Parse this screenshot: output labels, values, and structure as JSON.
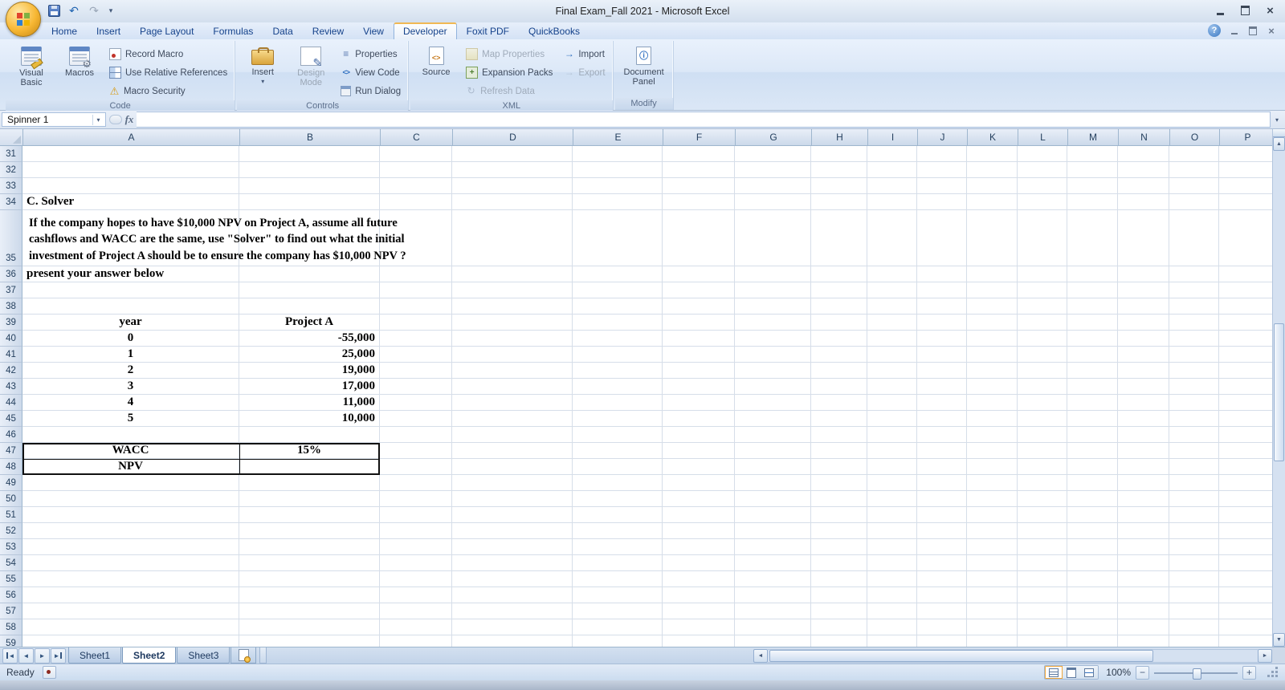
{
  "window": {
    "title": "Final Exam_Fall 2021  -  Microsoft Excel"
  },
  "ribbon": {
    "tabs": [
      "Home",
      "Insert",
      "Page Layout",
      "Formulas",
      "Data",
      "Review",
      "View",
      "Developer",
      "Foxit PDF",
      "QuickBooks"
    ],
    "active_tab": "Developer",
    "groups": {
      "code": {
        "label": "Code",
        "visual_basic": "Visual Basic",
        "macros": "Macros",
        "record_macro": "Record Macro",
        "use_relative_references": "Use Relative References",
        "macro_security": "Macro Security"
      },
      "controls": {
        "label": "Controls",
        "insert": "Insert",
        "design_mode": "Design Mode",
        "properties": "Properties",
        "view_code": "View Code",
        "run_dialog": "Run Dialog"
      },
      "xml": {
        "label": "XML",
        "source": "Source",
        "map_properties": "Map Properties",
        "expansion_packs": "Expansion Packs",
        "refresh_data": "Refresh Data",
        "import": "Import",
        "export": "Export"
      },
      "modify": {
        "label": "Modify",
        "document_panel": "Document Panel"
      }
    }
  },
  "formula_bar": {
    "name_box": "Spinner 1",
    "fx": "fx",
    "formula": ""
  },
  "grid": {
    "columns": [
      "A",
      "B",
      "C",
      "D",
      "E",
      "F",
      "G",
      "H",
      "I",
      "J",
      "K",
      "L",
      "M",
      "N",
      "O",
      "P"
    ],
    "rows": [
      31,
      32,
      33,
      34,
      35,
      36,
      37,
      38,
      39,
      40,
      41,
      42,
      43,
      44,
      45,
      46,
      47,
      48,
      49,
      50,
      51,
      52,
      53,
      54,
      55,
      56,
      57,
      58,
      59
    ],
    "cells": {
      "A34": {
        "text": "C. Solver",
        "align": "left"
      },
      "A35": {
        "text": "If the company hopes to have $10,000 NPV on Project A, assume all future\ncashflows and WACC are the same, use \"Solver\" to find out what the initial\ninvestment of Project A should be to ensure the company has $10,000 NPV ?",
        "align": "left",
        "spill": true
      },
      "A36": {
        "text": "present your answer below",
        "align": "left"
      },
      "A39": {
        "text": "year",
        "align": "center"
      },
      "B39": {
        "text": "Project A",
        "align": "center"
      },
      "A40": {
        "text": "0",
        "align": "center"
      },
      "B40": {
        "text": "-55,000",
        "align": "right"
      },
      "A41": {
        "text": "1",
        "align": "center"
      },
      "B41": {
        "text": "25,000",
        "align": "right"
      },
      "A42": {
        "text": "2",
        "align": "center"
      },
      "B42": {
        "text": "19,000",
        "align": "right"
      },
      "A43": {
        "text": "3",
        "align": "center"
      },
      "B43": {
        "text": "17,000",
        "align": "right"
      },
      "A44": {
        "text": "4",
        "align": "center"
      },
      "B44": {
        "text": "11,000",
        "align": "right"
      },
      "A45": {
        "text": "5",
        "align": "center"
      },
      "B45": {
        "text": "10,000",
        "align": "right"
      },
      "A47": {
        "text": "WACC",
        "align": "center"
      },
      "B47": {
        "text": "15%",
        "align": "center"
      },
      "A48": {
        "text": "NPV",
        "align": "center"
      }
    }
  },
  "sheets": {
    "tabs": [
      "Sheet1",
      "Sheet2",
      "Sheet3"
    ],
    "active": "Sheet2"
  },
  "status": {
    "mode": "Ready",
    "zoom": "100%"
  },
  "icons": {
    "undo": "↶",
    "redo": "↷",
    "dropdown": "▾",
    "warning": "⚠",
    "help": "?",
    "close": "×",
    "menu": "≡",
    "code_tag": "<>",
    "refresh": "↻",
    "arrow_right": "→",
    "left": "◄",
    "right": "►",
    "up": "▲",
    "down": "▼",
    "zoom_out": "−",
    "zoom_in": "+"
  }
}
